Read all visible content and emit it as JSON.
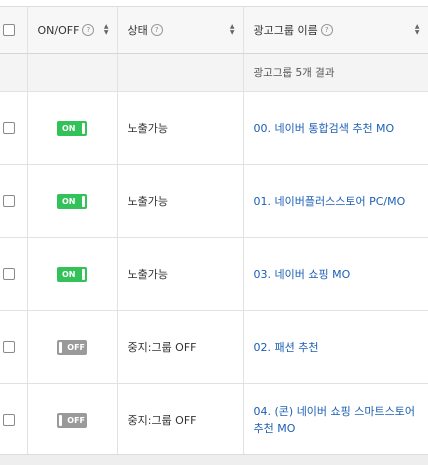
{
  "header": {
    "onoff_label": "ON/OFF",
    "status_label": "상태",
    "name_label": "광고그룹 이름",
    "help_glyph": "?"
  },
  "summary": {
    "text": "광고그룹 5개 결과"
  },
  "rows": [
    {
      "toggle": "ON",
      "status": "노출가능",
      "name": "00. 네이버 통합검색 추천 MO"
    },
    {
      "toggle": "ON",
      "status": "노출가능",
      "name": "01. 네이버플러스스토어 PC/MO"
    },
    {
      "toggle": "ON",
      "status": "노출가능",
      "name": "03. 네이버 쇼핑 MO"
    },
    {
      "toggle": "OFF",
      "status": "중지:그룹 OFF",
      "name": "02. 패션 추천"
    },
    {
      "toggle": "OFF",
      "status": "중지:그룹 OFF",
      "name": "04. (콘) 네이버 쇼핑 스마트스토어 추천 MO"
    }
  ],
  "colors": {
    "on": "#33c15a",
    "off": "#9a9a9a",
    "link": "#1c5fb5"
  },
  "icons": {
    "help": "help-circle-icon",
    "sort": "sort-icon"
  }
}
